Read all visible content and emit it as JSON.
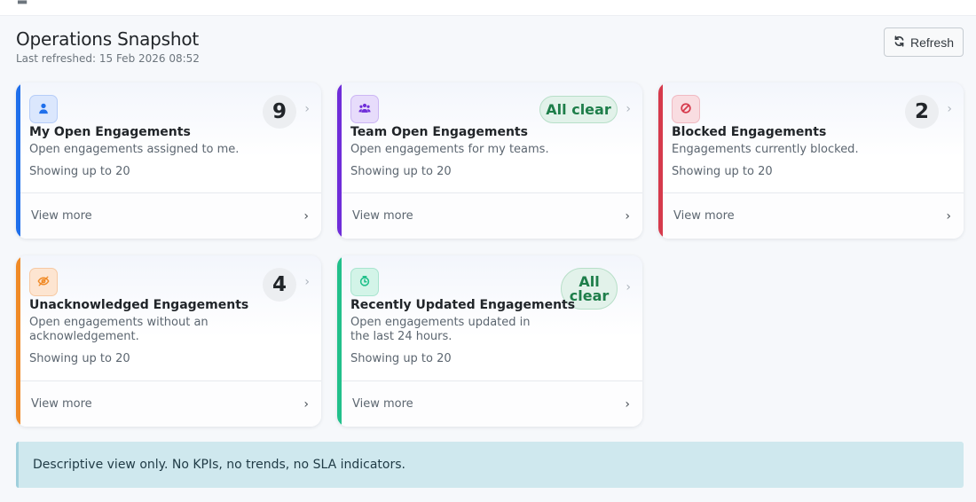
{
  "header": {
    "title": "Operations Snapshot",
    "last_refreshed": "Last refreshed: 15 Feb 2026 08:52",
    "refresh_label": "Refresh"
  },
  "cards": [
    {
      "title": "My Open Engagements",
      "description": "Open engagements assigned to me.",
      "limit": "Showing up to 20",
      "count": "9",
      "view_more": "View more",
      "icon": "user-icon",
      "accent": "#1f6feb"
    },
    {
      "title": "Team Open Engagements",
      "description": "Open engagements for my teams.",
      "limit": "Showing up to 20",
      "count": "All clear",
      "view_more": "View more",
      "icon": "users-icon",
      "accent": "#6f2dd9"
    },
    {
      "title": "Blocked Engagements",
      "description": "Engagements currently blocked.",
      "limit": "Showing up to 20",
      "count": "2",
      "view_more": "View more",
      "icon": "ban-icon",
      "accent": "#d63a4c"
    },
    {
      "title": "Unacknowledged Engagements",
      "description": "Open engagements without an acknowledgement.",
      "limit": "Showing up to 20",
      "count": "4",
      "view_more": "View more",
      "icon": "eye-slash-icon",
      "accent": "#f08a26"
    },
    {
      "title": "Recently Updated Engagements",
      "description": "Open engagements updated in the last 24 hours.",
      "limit": "Showing up to 20",
      "count": "All clear",
      "view_more": "View more",
      "icon": "clock-icon",
      "accent": "#21c08b"
    }
  ],
  "notice": "Descriptive view only. No KPIs, no trends, no SLA indicators.",
  "glyphs": {
    "chevron": "›"
  }
}
